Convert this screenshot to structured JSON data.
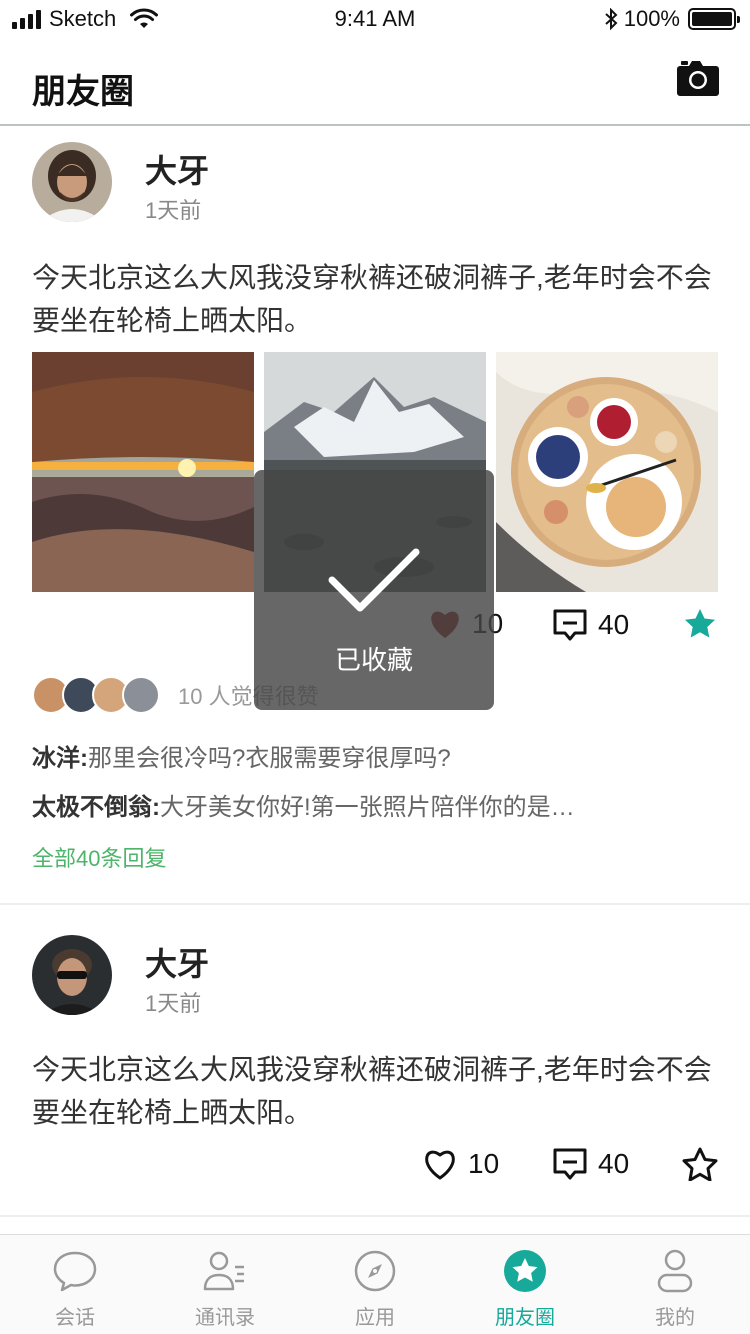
{
  "status_bar": {
    "carrier": "Sketch",
    "time": "9:41 AM",
    "battery": "100%"
  },
  "nav": {
    "title": "朋友圈",
    "camera_icon": "camera-icon"
  },
  "posts": [
    {
      "author": "大牙",
      "time": "1天前",
      "text": "今天北京这么大风我没穿秋裤还破洞裤子,老年时会不会要坐在轮椅上晒太阳。",
      "photos": [
        "canyon-sunset-photo",
        "snow-mountain-lake-photo",
        "breakfast-tray-photo"
      ],
      "likes": "10",
      "comments": "40",
      "liked": true,
      "favorited": true,
      "likes_text": "10 人觉得很赞",
      "comment_list": [
        {
          "user": "冰洋:",
          "text": "那里会很冷吗?衣服需要穿很厚吗?"
        },
        {
          "user": "太极不倒翁:",
          "text": "大牙美女你好!第一张照片陪伴你的是…"
        }
      ],
      "all_replies": "全部40条回复"
    },
    {
      "author": "大牙",
      "time": "1天前",
      "text": "今天北京这么大风我没穿秋裤还破洞裤子,老年时会不会要坐在轮椅上晒太阳。",
      "likes": "10",
      "comments": "40",
      "liked": false,
      "favorited": false
    }
  ],
  "toast": {
    "text": "已收藏",
    "icon": "checkmark-icon"
  },
  "tabs": [
    {
      "label": "会话",
      "icon": "chat-bubble-icon",
      "active": false
    },
    {
      "label": "通讯录",
      "icon": "contacts-icon",
      "active": false
    },
    {
      "label": "应用",
      "icon": "compass-icon",
      "active": false
    },
    {
      "label": "朋友圈",
      "icon": "star-circle-icon",
      "active": true
    },
    {
      "label": "我的",
      "icon": "person-icon",
      "active": false
    }
  ],
  "colors": {
    "accent": "#17a99a",
    "like_red": "#8b1a1a",
    "link_green": "#4cb56a",
    "text": "#333333"
  }
}
